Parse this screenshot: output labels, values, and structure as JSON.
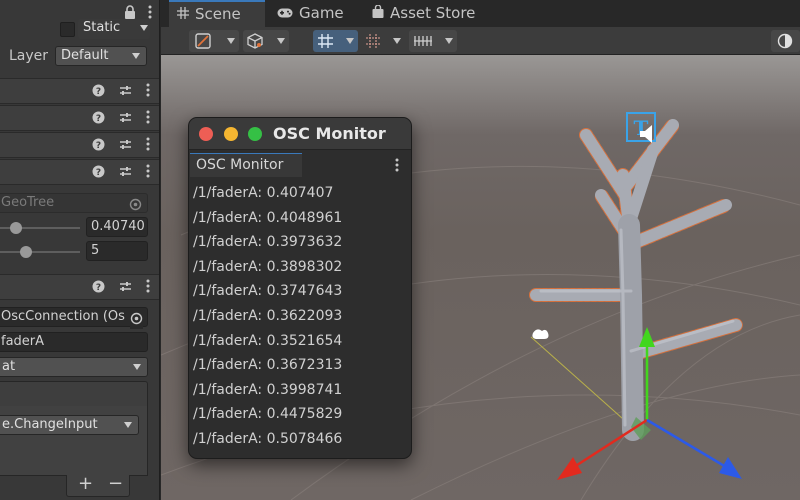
{
  "inspector": {
    "static_label": "Static",
    "layer_label": "Layer",
    "layer_value": "Default",
    "component_name": "GeoTree",
    "slider_value": "0.40740",
    "int_value": "5",
    "osc_connection": "OscConnection (Os",
    "address": "faderA",
    "type_value": "at",
    "callback": "e.ChangeInput",
    "add_label": "+",
    "remove_label": "−"
  },
  "tabs": [
    {
      "label": "Scene",
      "icon": "grid-icon"
    },
    {
      "label": "Game",
      "icon": "gamepad-icon"
    },
    {
      "label": "Asset Store",
      "icon": "shopping-bag-icon"
    }
  ],
  "osc_monitor": {
    "title": "OSC Monitor",
    "tab_label": "OSC Monitor",
    "messages": [
      "/1/faderA: 0.407407",
      "/1/faderA: 0.4048961",
      "/1/faderA: 0.3973632",
      "/1/faderA: 0.3898302",
      "/1/faderA: 0.3747643",
      "/1/faderA: 0.3622093",
      "/1/faderA: 0.3521654",
      "/1/faderA: 0.3672313",
      "/1/faderA: 0.3998741",
      "/1/faderA: 0.4475829",
      "/1/faderA: 0.5078466"
    ]
  },
  "colors": {
    "accent": "#3a79bb",
    "close": "#ee5e55",
    "minimize": "#f5b631",
    "maximize": "#35c045",
    "selection_outline": "#e2733a",
    "gizmo_x": "#e22a1e",
    "gizmo_y": "#42d61e",
    "gizmo_z": "#2c5ae8"
  }
}
